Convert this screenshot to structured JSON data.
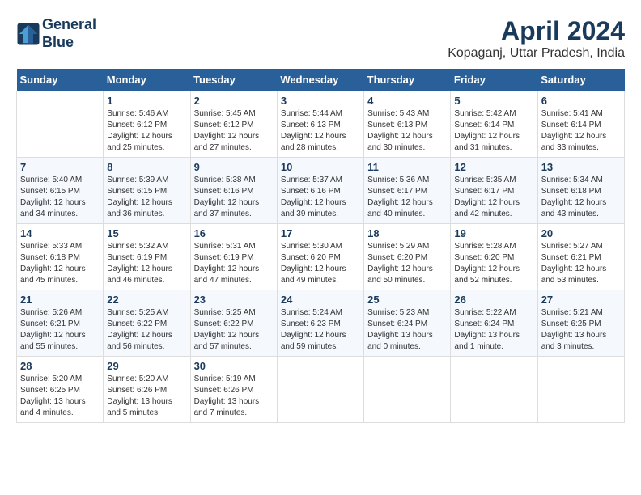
{
  "header": {
    "logo_line1": "General",
    "logo_line2": "Blue",
    "month_year": "April 2024",
    "location": "Kopaganj, Uttar Pradesh, India"
  },
  "days_of_week": [
    "Sunday",
    "Monday",
    "Tuesday",
    "Wednesday",
    "Thursday",
    "Friday",
    "Saturday"
  ],
  "weeks": [
    [
      {
        "day": "",
        "info": ""
      },
      {
        "day": "1",
        "info": "Sunrise: 5:46 AM\nSunset: 6:12 PM\nDaylight: 12 hours\nand 25 minutes."
      },
      {
        "day": "2",
        "info": "Sunrise: 5:45 AM\nSunset: 6:12 PM\nDaylight: 12 hours\nand 27 minutes."
      },
      {
        "day": "3",
        "info": "Sunrise: 5:44 AM\nSunset: 6:13 PM\nDaylight: 12 hours\nand 28 minutes."
      },
      {
        "day": "4",
        "info": "Sunrise: 5:43 AM\nSunset: 6:13 PM\nDaylight: 12 hours\nand 30 minutes."
      },
      {
        "day": "5",
        "info": "Sunrise: 5:42 AM\nSunset: 6:14 PM\nDaylight: 12 hours\nand 31 minutes."
      },
      {
        "day": "6",
        "info": "Sunrise: 5:41 AM\nSunset: 6:14 PM\nDaylight: 12 hours\nand 33 minutes."
      }
    ],
    [
      {
        "day": "7",
        "info": "Sunrise: 5:40 AM\nSunset: 6:15 PM\nDaylight: 12 hours\nand 34 minutes."
      },
      {
        "day": "8",
        "info": "Sunrise: 5:39 AM\nSunset: 6:15 PM\nDaylight: 12 hours\nand 36 minutes."
      },
      {
        "day": "9",
        "info": "Sunrise: 5:38 AM\nSunset: 6:16 PM\nDaylight: 12 hours\nand 37 minutes."
      },
      {
        "day": "10",
        "info": "Sunrise: 5:37 AM\nSunset: 6:16 PM\nDaylight: 12 hours\nand 39 minutes."
      },
      {
        "day": "11",
        "info": "Sunrise: 5:36 AM\nSunset: 6:17 PM\nDaylight: 12 hours\nand 40 minutes."
      },
      {
        "day": "12",
        "info": "Sunrise: 5:35 AM\nSunset: 6:17 PM\nDaylight: 12 hours\nand 42 minutes."
      },
      {
        "day": "13",
        "info": "Sunrise: 5:34 AM\nSunset: 6:18 PM\nDaylight: 12 hours\nand 43 minutes."
      }
    ],
    [
      {
        "day": "14",
        "info": "Sunrise: 5:33 AM\nSunset: 6:18 PM\nDaylight: 12 hours\nand 45 minutes."
      },
      {
        "day": "15",
        "info": "Sunrise: 5:32 AM\nSunset: 6:19 PM\nDaylight: 12 hours\nand 46 minutes."
      },
      {
        "day": "16",
        "info": "Sunrise: 5:31 AM\nSunset: 6:19 PM\nDaylight: 12 hours\nand 47 minutes."
      },
      {
        "day": "17",
        "info": "Sunrise: 5:30 AM\nSunset: 6:20 PM\nDaylight: 12 hours\nand 49 minutes."
      },
      {
        "day": "18",
        "info": "Sunrise: 5:29 AM\nSunset: 6:20 PM\nDaylight: 12 hours\nand 50 minutes."
      },
      {
        "day": "19",
        "info": "Sunrise: 5:28 AM\nSunset: 6:20 PM\nDaylight: 12 hours\nand 52 minutes."
      },
      {
        "day": "20",
        "info": "Sunrise: 5:27 AM\nSunset: 6:21 PM\nDaylight: 12 hours\nand 53 minutes."
      }
    ],
    [
      {
        "day": "21",
        "info": "Sunrise: 5:26 AM\nSunset: 6:21 PM\nDaylight: 12 hours\nand 55 minutes."
      },
      {
        "day": "22",
        "info": "Sunrise: 5:25 AM\nSunset: 6:22 PM\nDaylight: 12 hours\nand 56 minutes."
      },
      {
        "day": "23",
        "info": "Sunrise: 5:25 AM\nSunset: 6:22 PM\nDaylight: 12 hours\nand 57 minutes."
      },
      {
        "day": "24",
        "info": "Sunrise: 5:24 AM\nSunset: 6:23 PM\nDaylight: 12 hours\nand 59 minutes."
      },
      {
        "day": "25",
        "info": "Sunrise: 5:23 AM\nSunset: 6:24 PM\nDaylight: 13 hours\nand 0 minutes."
      },
      {
        "day": "26",
        "info": "Sunrise: 5:22 AM\nSunset: 6:24 PM\nDaylight: 13 hours\nand 1 minute."
      },
      {
        "day": "27",
        "info": "Sunrise: 5:21 AM\nSunset: 6:25 PM\nDaylight: 13 hours\nand 3 minutes."
      }
    ],
    [
      {
        "day": "28",
        "info": "Sunrise: 5:20 AM\nSunset: 6:25 PM\nDaylight: 13 hours\nand 4 minutes."
      },
      {
        "day": "29",
        "info": "Sunrise: 5:20 AM\nSunset: 6:26 PM\nDaylight: 13 hours\nand 5 minutes."
      },
      {
        "day": "30",
        "info": "Sunrise: 5:19 AM\nSunset: 6:26 PM\nDaylight: 13 hours\nand 7 minutes."
      },
      {
        "day": "",
        "info": ""
      },
      {
        "day": "",
        "info": ""
      },
      {
        "day": "",
        "info": ""
      },
      {
        "day": "",
        "info": ""
      }
    ]
  ]
}
